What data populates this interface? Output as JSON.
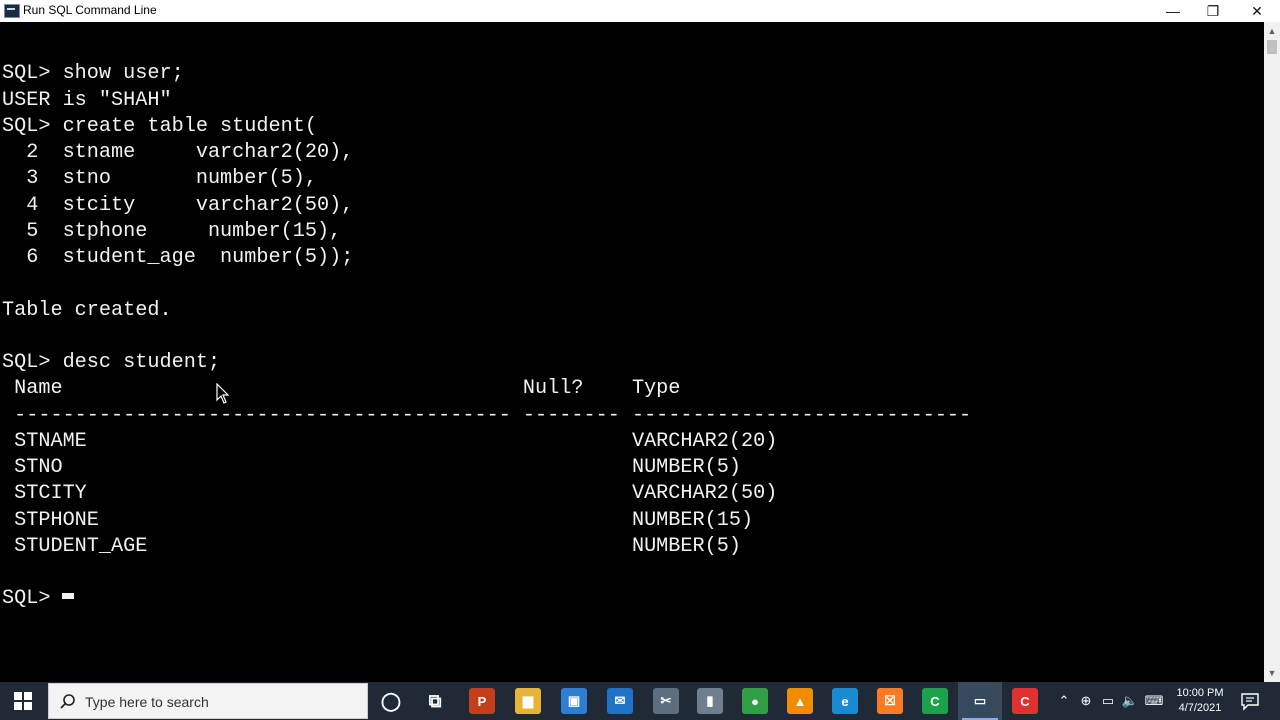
{
  "window": {
    "title": "Run SQL Command Line",
    "minimize_glyph": "—",
    "maximize_glyph": "❐",
    "close_glyph": "✕"
  },
  "console": {
    "lines": [
      "",
      "SQL> show user;",
      "USER is \"SHAH\"",
      "SQL> create table student(",
      "  2  stname     varchar2(20),",
      "  3  stno       number(5),",
      "  4  stcity     varchar2(50),",
      "  5  stphone     number(15),",
      "  6  student_age  number(5));",
      "",
      "Table created.",
      "",
      "SQL> desc student;",
      " Name                                      Null?    Type",
      " ----------------------------------------- -------- ----------------------------",
      " STNAME                                             VARCHAR2(20)",
      " STNO                                               NUMBER(5)",
      " STCITY                                             VARCHAR2(50)",
      " STPHONE                                            NUMBER(15)",
      " STUDENT_AGE                                        NUMBER(5)",
      "",
      "SQL> "
    ]
  },
  "taskbar": {
    "search_placeholder": "Type here to search",
    "clock_time": "10:00 PM",
    "clock_date": "4/7/2021",
    "icons": [
      {
        "name": "cortana-icon",
        "glyph": "◯",
        "bg": "transparent"
      },
      {
        "name": "task-view-icon",
        "glyph": "⧉",
        "bg": "transparent"
      },
      {
        "name": "powerpoint-icon",
        "glyph": "P",
        "bg": "#c43e1c"
      },
      {
        "name": "file-explorer-icon",
        "glyph": "▆",
        "bg": "#e8b339"
      },
      {
        "name": "store-icon",
        "glyph": "▣",
        "bg": "#2d7fd3"
      },
      {
        "name": "mail-icon",
        "glyph": "✉",
        "bg": "#1e73c9"
      },
      {
        "name": "snipping-tool-icon",
        "glyph": "✂",
        "bg": "#5c6f82"
      },
      {
        "name": "device-icon",
        "glyph": "▮",
        "bg": "#6f7f8f"
      },
      {
        "name": "chrome-icon",
        "glyph": "●",
        "bg": "#2f9e44"
      },
      {
        "name": "vlc-icon",
        "glyph": "▲",
        "bg": "#f08c00"
      },
      {
        "name": "edge-icon",
        "glyph": "e",
        "bg": "#1b8bd1"
      },
      {
        "name": "xampp-icon",
        "glyph": "☒",
        "bg": "#fb7a24"
      },
      {
        "name": "camtasia-icon",
        "glyph": "C",
        "bg": "#1aa34a"
      },
      {
        "name": "sql-command-line-icon",
        "glyph": "▭",
        "bg": "#34495e"
      },
      {
        "name": "recorder-icon",
        "glyph": "C",
        "bg": "#e03131"
      }
    ],
    "tray": [
      {
        "name": "show-hidden-icons-icon",
        "glyph": "⌃"
      },
      {
        "name": "network-globe-icon",
        "glyph": "⊕"
      },
      {
        "name": "battery-icon",
        "glyph": "▭"
      },
      {
        "name": "volume-icon",
        "glyph": "🔈"
      },
      {
        "name": "keyboard-icon",
        "glyph": "⌨"
      }
    ]
  }
}
